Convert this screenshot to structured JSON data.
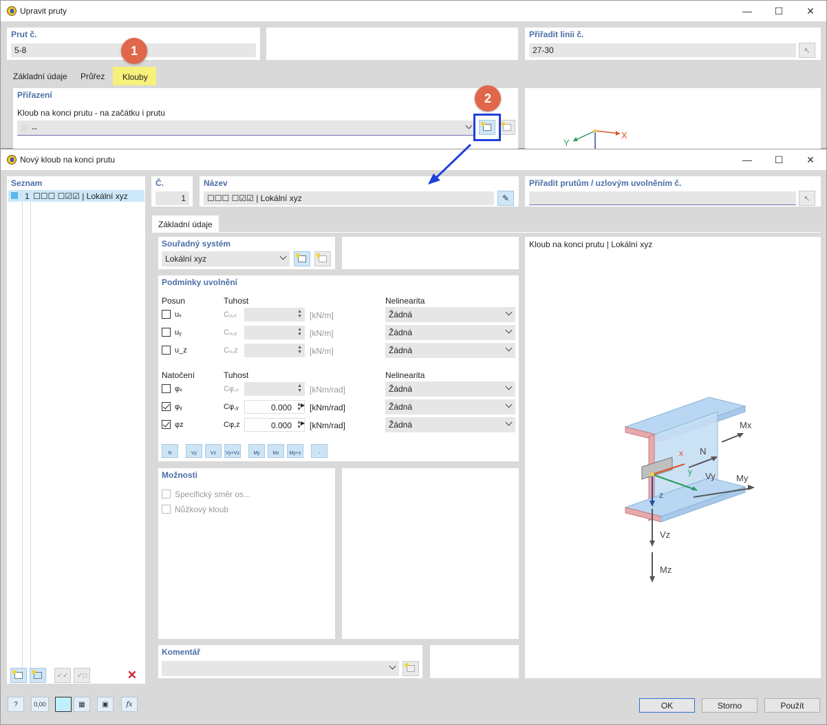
{
  "outer": {
    "title": "Upravit pruty",
    "prut_label": "Prut č.",
    "prut_value": "5-8",
    "assign_label": "Přiřadit linii č.",
    "assign_value": "27-30",
    "tabs": [
      "Základní údaje",
      "Průřez",
      "Klouby"
    ],
    "section_label": "Přiřazení",
    "hinge_label": "Kloub na konci prutu - na začátku i prutu",
    "hinge_value": "--",
    "badge1": "1",
    "badge2": "2",
    "axis_y": "Y",
    "axis_x": "X"
  },
  "dialog": {
    "title": "Nový kloub na konci prutu",
    "list_label": "Seznam",
    "list_items": [
      {
        "num": "1",
        "text": "☐☐☐ ☐☑☑ | Lokální xyz"
      }
    ],
    "no_label": "Č.",
    "no_value": "1",
    "name_label": "Název",
    "name_value": "☐☐☐ ☐☑☑ | Lokální xyz",
    "assign_label": "Přiřadit prutům / uzlovým uvolněním č.",
    "assign_value": "",
    "tab": "Základní údaje",
    "coord_label": "Souřadný systém",
    "coord_value": "Lokální xyz",
    "release_label": "Podmínky uvolnění",
    "posun_label": "Posun",
    "tuhost_label": "Tuhost",
    "nelin_label": "Nelinearita",
    "natoceni_label": "Natočení",
    "translations": [
      {
        "sym": "uₓ",
        "c": "Cᵤ,ₓ",
        "value": "",
        "unit": "[kN/m]",
        "nonlin": "Žádná",
        "checked": false
      },
      {
        "sym": "uᵧ",
        "c": "Cᵤ,ᵧ",
        "value": "",
        "unit": "[kN/m]",
        "nonlin": "Žádná",
        "checked": false
      },
      {
        "sym": "u_z",
        "c": "Cᵤ,z",
        "value": "",
        "unit": "[kN/m]",
        "nonlin": "Žádná",
        "checked": false
      }
    ],
    "rotations": [
      {
        "sym": "φₓ",
        "c": "Cφ,ₓ",
        "value": "",
        "unit": "[kNm/rad]",
        "nonlin": "Žádná",
        "checked": false
      },
      {
        "sym": "φᵧ",
        "c": "Cφ,ᵧ",
        "value": "0.000",
        "unit": "[kNm/rad]",
        "nonlin": "Žádná",
        "checked": true
      },
      {
        "sym": "φz",
        "c": "Cφ,z",
        "value": "0.000",
        "unit": "[kNm/rad]",
        "nonlin": "Žádná",
        "checked": true
      }
    ],
    "toolbar": [
      "N",
      "Vy",
      "Vz",
      "Vy+Vz",
      "My",
      "Mz",
      "My+z",
      "-"
    ],
    "options_label": "Možnosti",
    "option1": "Specifický směr os...",
    "option2": "Nůžkový kloub",
    "comment_label": "Komentář",
    "comment_value": "",
    "preview_title": "Kloub na konci prutu | Lokální xyz",
    "preview_labels": {
      "mx": "Mx",
      "n": "N",
      "x": "x",
      "y": "y",
      "vy": "Vy",
      "my": "My",
      "z": "z",
      "vz": "Vz",
      "mz": "Mz"
    },
    "ok": "OK",
    "cancel": "Storno",
    "apply": "Použít",
    "status_value": "0,00"
  },
  "colors": {
    "accent": "#4a6ea8",
    "badge": "#e0674a",
    "highlight_tab": "#f7f07a",
    "callout": "#1f3fdc"
  }
}
